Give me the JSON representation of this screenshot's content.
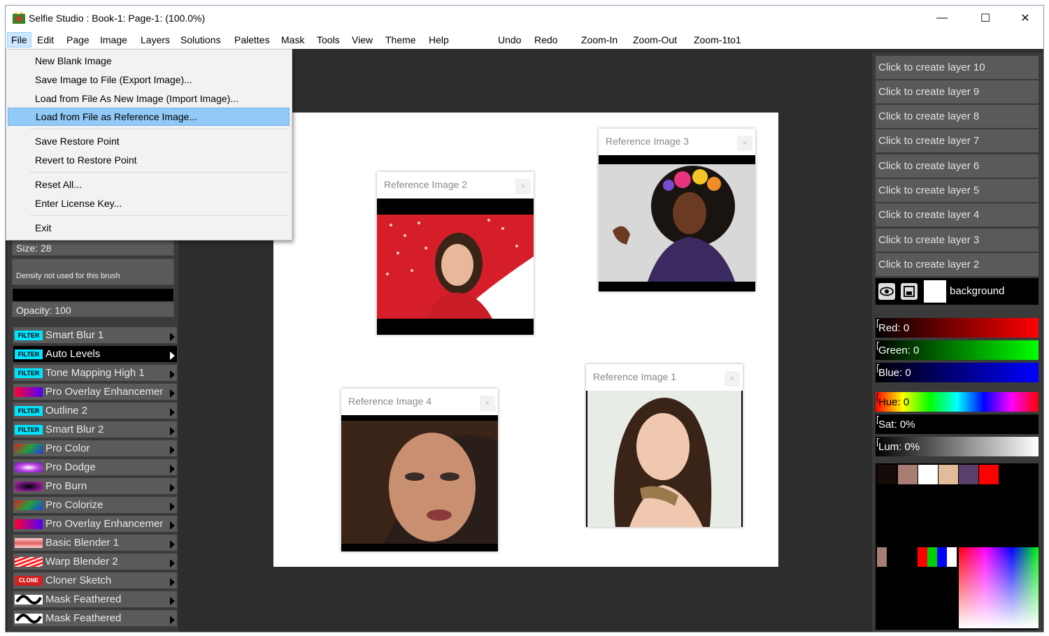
{
  "window": {
    "title": "Selfie Studio : Book-1: Page-1:  (100.0%)",
    "minimize": "—",
    "maximize": "☐",
    "close": "✕"
  },
  "menubar": {
    "items": [
      "File",
      "Edit",
      "Page",
      "Image",
      "Layers",
      "Solutions",
      "Palettes",
      "Mask",
      "Tools",
      "View",
      "Theme",
      "Help"
    ],
    "actions": [
      "Undo",
      "Redo",
      "Zoom-In",
      "Zoom-Out",
      "Zoom-1to1"
    ]
  },
  "file_menu": {
    "items": [
      "New Blank Image",
      "Save Image to File (Export Image)...",
      "Load from File As New Image (Import Image)...",
      "Load from File as Reference Image...",
      "Save Restore Point",
      "Revert to Restore Point",
      "Reset All...",
      "Enter License Key...",
      "Exit"
    ],
    "highlighted_index": 3
  },
  "brush_props": {
    "size": "Size: 28",
    "density": "Density not used for this brush",
    "opacity": "Opacity: 100"
  },
  "brushes": [
    {
      "icon": "FILTER",
      "label": "Smart Blur 1"
    },
    {
      "icon": "FILTER",
      "label": "Auto Levels",
      "selected": true
    },
    {
      "icon": "FILTER",
      "label": "Tone Mapping High 1"
    },
    {
      "icon": "",
      "label": "Pro Overlay Enhancement"
    },
    {
      "icon": "FILTER",
      "label": "Outline 2"
    },
    {
      "icon": "FILTER",
      "label": "Smart Blur 2"
    },
    {
      "icon": "",
      "label": "Pro Color"
    },
    {
      "icon": "",
      "label": "Pro Dodge"
    },
    {
      "icon": "",
      "label": "Pro Burn"
    },
    {
      "icon": "",
      "label": "Pro Colorize"
    },
    {
      "icon": "",
      "label": "Pro Overlay Enhancement"
    },
    {
      "icon": "",
      "label": "Basic Blender 1"
    },
    {
      "icon": "",
      "label": "Warp Blender 2"
    },
    {
      "icon": "CLONE",
      "label": "Cloner Sketch"
    },
    {
      "icon": "",
      "label": "Mask Feathered"
    },
    {
      "icon": "",
      "label": "Mask Feathered"
    }
  ],
  "reference_images": [
    {
      "title": "Reference Image 2",
      "close": "×"
    },
    {
      "title": "Reference Image 3",
      "close": "×"
    },
    {
      "title": "Reference Image 4",
      "close": "×"
    },
    {
      "title": "Reference Image 1",
      "close": "×"
    }
  ],
  "layers": [
    "Click to create layer 10",
    "Click to create layer 9",
    "Click to create layer 8",
    "Click to create layer 7",
    "Click to create layer 6",
    "Click to create layer 5",
    "Click to create layer 4",
    "Click to create layer 3",
    "Click to create layer 2"
  ],
  "background_layer": {
    "label": "background",
    "eye": "👁",
    "lock": "🔒"
  },
  "color_sliders": {
    "red": "Red: 0",
    "green": "Green: 0",
    "blue": "Blue: 0",
    "hue": "Hue: 0",
    "sat": "Sat: 0%",
    "lum": "Lum: 0%"
  },
  "palette_colors": [
    "#150b09",
    "#a87d74",
    "#ffffff",
    "#e2bc9a",
    "#5a3f6a",
    "#ff0000"
  ],
  "accent": {
    "menu_highlight": "#91c9f7",
    "filter_cyan": "#00e5ff"
  }
}
